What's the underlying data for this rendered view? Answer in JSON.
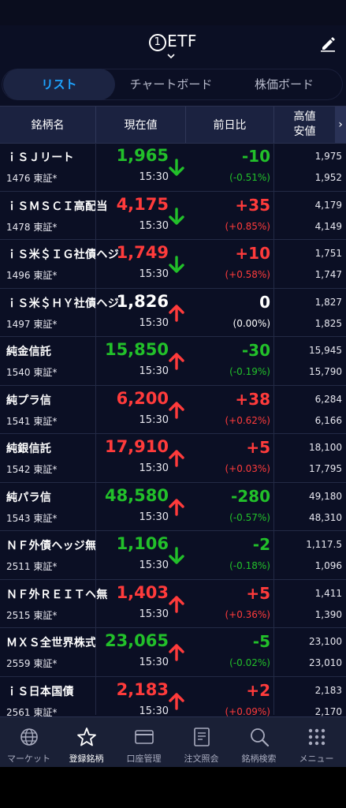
{
  "header": {
    "title_num": "1",
    "title": "ETF"
  },
  "tabs": [
    {
      "label": "リスト",
      "active": true
    },
    {
      "label": "チャートボード",
      "active": false
    },
    {
      "label": "株価ボード",
      "active": false
    }
  ],
  "columns": {
    "name": "銘柄名",
    "price": "現在値",
    "change": "前日比",
    "high": "高値",
    "low": "安値",
    "more": "›"
  },
  "rows": [
    {
      "name": "ｉＳＪリート",
      "code": "1476 東証*",
      "price": "1,965",
      "price_color": "green",
      "arrow": "down",
      "time": "15:30",
      "change": "-10",
      "pct": "(-0.51%)",
      "chg_color": "green",
      "high": "1,975",
      "low": "1,952"
    },
    {
      "name": "ｉＳＭＳＣＩ高配当",
      "code": "1478 東証*",
      "price": "4,175",
      "price_color": "red",
      "arrow": "down",
      "time": "15:30",
      "change": "+35",
      "pct": "(+0.85%)",
      "chg_color": "red",
      "high": "4,179",
      "low": "4,149"
    },
    {
      "name": "ｉＳ米＄ＩＧ社債ヘジ",
      "code": "1496 東証*",
      "price": "1,749",
      "price_color": "red",
      "arrow": "down",
      "time": "15:30",
      "change": "+10",
      "pct": "(+0.58%)",
      "chg_color": "red",
      "high": "1,751",
      "low": "1,747"
    },
    {
      "name": "ｉＳ米＄ＨＹ社債ヘジ",
      "code": "1497 東証*",
      "price": "1,826",
      "price_color": "white",
      "arrow": "up",
      "time": "15:30",
      "change": "0",
      "pct": "(0.00%)",
      "chg_color": "white",
      "high": "1,827",
      "low": "1,825"
    },
    {
      "name": "純金信託",
      "code": "1540 東証*",
      "price": "15,850",
      "price_color": "green",
      "arrow": "up",
      "time": "15:30",
      "change": "-30",
      "pct": "(-0.19%)",
      "chg_color": "green",
      "high": "15,945",
      "low": "15,790"
    },
    {
      "name": "純プラ信",
      "code": "1541 東証*",
      "price": "6,200",
      "price_color": "red",
      "arrow": "up",
      "time": "15:30",
      "change": "+38",
      "pct": "(+0.62%)",
      "chg_color": "red",
      "high": "6,284",
      "low": "6,166"
    },
    {
      "name": "純銀信託",
      "code": "1542 東証*",
      "price": "17,910",
      "price_color": "red",
      "arrow": "up",
      "time": "15:30",
      "change": "+5",
      "pct": "(+0.03%)",
      "chg_color": "red",
      "high": "18,100",
      "low": "17,795"
    },
    {
      "name": "純パラ信",
      "code": "1543 東証*",
      "price": "48,580",
      "price_color": "green",
      "arrow": "up",
      "time": "15:30",
      "change": "-280",
      "pct": "(-0.57%)",
      "chg_color": "green",
      "high": "49,180",
      "low": "48,310"
    },
    {
      "name": "ＮＦ外債ヘッジ無",
      "code": "2511 東証*",
      "price": "1,106",
      "price_color": "green",
      "arrow": "down",
      "time": "15:30",
      "change": "-2",
      "pct": "(-0.18%)",
      "chg_color": "green",
      "high": "1,117.5",
      "low": "1,096"
    },
    {
      "name": "ＮＦ外ＲＥＩＴヘ無",
      "code": "2515 東証*",
      "price": "1,403",
      "price_color": "red",
      "arrow": "up",
      "time": "15:30",
      "change": "+5",
      "pct": "(+0.36%)",
      "chg_color": "red",
      "high": "1,411",
      "low": "1,390"
    },
    {
      "name": "ＭＸＳ全世界株式",
      "code": "2559 東証*",
      "price": "23,065",
      "price_color": "green",
      "arrow": "up",
      "time": "15:30",
      "change": "-5",
      "pct": "(-0.02%)",
      "chg_color": "green",
      "high": "23,100",
      "low": "23,010"
    },
    {
      "name": "ｉＳ日本国債",
      "code": "2561 東証*",
      "price": "2,183",
      "price_color": "red",
      "arrow": "up",
      "time": "15:30",
      "change": "+2",
      "pct": "(+0.09%)",
      "chg_color": "red",
      "high": "2,183",
      "low": "2,170"
    }
  ],
  "nav": [
    {
      "label": "マーケット",
      "icon": "globe-icon",
      "active": false
    },
    {
      "label": "登録銘柄",
      "icon": "star-icon",
      "active": true
    },
    {
      "label": "口座管理",
      "icon": "card-icon",
      "active": false
    },
    {
      "label": "注文照会",
      "icon": "document-icon",
      "active": false
    },
    {
      "label": "銘柄検索",
      "icon": "search-icon",
      "active": false
    },
    {
      "label": "メニュー",
      "icon": "grid-icon",
      "active": false
    }
  ],
  "colors": {
    "up": "#ff3b3b",
    "down": "#22c02a",
    "accent": "#1ea3ff",
    "background": "#0b0f24"
  }
}
